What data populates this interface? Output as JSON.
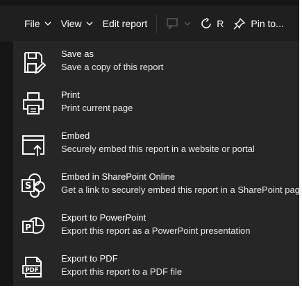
{
  "toolbar": {
    "file_label": "File",
    "view_label": "View",
    "edit_label": "Edit report",
    "refresh_label": "R",
    "pin_label": "Pin to..."
  },
  "menu": {
    "items": [
      {
        "title": "Save as",
        "description": "Save a copy of this report",
        "icon": "save-as-icon"
      },
      {
        "title": "Print",
        "description": "Print current page",
        "icon": "printer-icon"
      },
      {
        "title": "Embed",
        "description": "Securely embed this report in a website or portal",
        "icon": "embed-icon"
      },
      {
        "title": "Embed in SharePoint Online",
        "description": "Get a link to securely embed this report in a SharePoint page",
        "icon": "sharepoint-icon"
      },
      {
        "title": "Export to PowerPoint",
        "description": "Export this report as a PowerPoint presentation",
        "icon": "powerpoint-icon"
      },
      {
        "title": "Export to PDF",
        "description": "Export this report to a PDF file",
        "icon": "pdf-icon"
      }
    ]
  },
  "colors": {
    "background": "#151515",
    "menu": "#262626",
    "text": "#ffffff"
  }
}
